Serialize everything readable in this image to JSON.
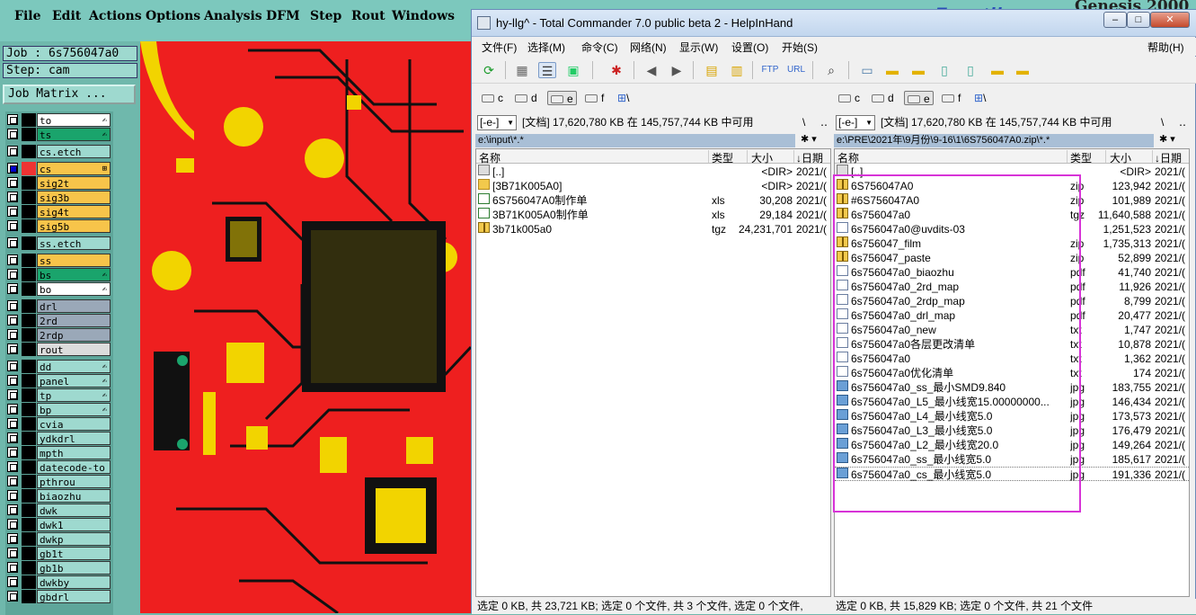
{
  "genesis": {
    "menu": [
      "File",
      "Edit",
      "Actions",
      "Options",
      "Analysis",
      "DFM",
      "Step",
      "Rout",
      "Windows"
    ],
    "brand": "Genesis 2000",
    "logo_text": "Frontline",
    "job": "Job : 6s756047a0",
    "step": "Step: cam",
    "job_matrix_button": "Job Matrix ...",
    "layers": [
      {
        "name": "to",
        "color": "#ffffff",
        "mark": "✍"
      },
      {
        "name": "ts",
        "color": "#1aa46c",
        "mark": "✍"
      },
      {
        "name": "cs.etch",
        "color": "#9ed9cf",
        "mark": ""
      },
      {
        "name": "cs",
        "color": "#f7c44a",
        "mark": "⊞",
        "selected": true,
        "swatch": "#e33"
      },
      {
        "name": "sig2t",
        "color": "#f7c44a",
        "mark": ""
      },
      {
        "name": "sig3b",
        "color": "#f7c44a",
        "mark": ""
      },
      {
        "name": "sig4t",
        "color": "#f7c44a",
        "mark": ""
      },
      {
        "name": "sig5b",
        "color": "#f7c44a",
        "mark": ""
      },
      {
        "name": "ss.etch",
        "color": "#9ed9cf",
        "mark": ""
      },
      {
        "name": "ss",
        "color": "#f7c44a",
        "mark": ""
      },
      {
        "name": "bs",
        "color": "#1aa46c",
        "mark": "✍"
      },
      {
        "name": "bo",
        "color": "#ffffff",
        "mark": "✍"
      },
      {
        "name": "drl",
        "color": "#9aa8b8",
        "mark": ""
      },
      {
        "name": "2rd",
        "color": "#9aa8b8",
        "mark": ""
      },
      {
        "name": "2rdp",
        "color": "#9aa8b8",
        "mark": ""
      },
      {
        "name": "rout",
        "color": "#dcdcdc",
        "mark": ""
      },
      {
        "name": "dd",
        "color": "#9ed9cf",
        "mark": "✍"
      },
      {
        "name": "panel",
        "color": "#9ed9cf",
        "mark": "✍"
      },
      {
        "name": "tp",
        "color": "#9ed9cf",
        "mark": "✍"
      },
      {
        "name": "bp",
        "color": "#9ed9cf",
        "mark": "✍"
      },
      {
        "name": "cvia",
        "color": "#9ed9cf",
        "mark": ""
      },
      {
        "name": "ydkdrl",
        "color": "#9ed9cf",
        "mark": ""
      },
      {
        "name": "mpth",
        "color": "#9ed9cf",
        "mark": ""
      },
      {
        "name": "datecode-to",
        "color": "#9ed9cf",
        "mark": ""
      },
      {
        "name": "pthrou",
        "color": "#9ed9cf",
        "mark": ""
      },
      {
        "name": "biaozhu",
        "color": "#9ed9cf",
        "mark": ""
      },
      {
        "name": "dwk",
        "color": "#9ed9cf",
        "mark": ""
      },
      {
        "name": "dwk1",
        "color": "#9ed9cf",
        "mark": ""
      },
      {
        "name": "dwkp",
        "color": "#9ed9cf",
        "mark": ""
      },
      {
        "name": "gb1t",
        "color": "#9ed9cf",
        "mark": ""
      },
      {
        "name": "gb1b",
        "color": "#9ed9cf",
        "mark": ""
      },
      {
        "name": "dwkby",
        "color": "#9ed9cf",
        "mark": ""
      },
      {
        "name": "gbdrl",
        "color": "#9ed9cf",
        "mark": ""
      }
    ]
  },
  "tc": {
    "title": "hy-llg^ - Total Commander 7.0 public beta 2 - HelpInHand",
    "menu": [
      "文件(F)",
      "选择(M)",
      "命令(C)",
      "网络(N)",
      "显示(W)",
      "设置(O)",
      "开始(S)"
    ],
    "help": "帮助(H)",
    "drives": [
      "c",
      "d",
      "e",
      "f"
    ],
    "net_drive": "\\",
    "left": {
      "drive_select": "[-e-]",
      "free_info": "[文档]  17,620,780 KB 在 145,757,744 KB 中可用",
      "path": "e:\\input\\*.*",
      "headers": {
        "name": "名称",
        "type": "类型",
        "size": "大小",
        "date": "↓日期"
      },
      "files": [
        {
          "name": "[..]",
          "type": "",
          "size": "<DIR>",
          "date": "2021/(",
          "icon": "up"
        },
        {
          "name": "[3B71K005A0]",
          "type": "",
          "size": "<DIR>",
          "date": "2021/(",
          "icon": "folder"
        },
        {
          "name": "6S756047A0制作单",
          "type": "xls",
          "size": "30,208",
          "date": "2021/(",
          "icon": "xls"
        },
        {
          "name": "3B71K005A0制作单",
          "type": "xls",
          "size": "29,184",
          "date": "2021/(",
          "icon": "xls"
        },
        {
          "name": "3b71k005a0",
          "type": "tgz",
          "size": "24,231,701",
          "date": "2021/(",
          "icon": "zip"
        }
      ]
    },
    "right": {
      "drive_select": "[-e-]",
      "free_info": "[文档]  17,620,780 KB 在 145,757,744 KB 中可用",
      "path": "e:\\PRE\\2021年\\9月份\\9-16\\1\\6S756047A0.zip\\*.*",
      "headers": {
        "name": "名称",
        "type": "类型",
        "size": "大小",
        "date": "↓日期"
      },
      "files": [
        {
          "name": "[..]",
          "type": "",
          "size": "<DIR>",
          "date": "2021/(",
          "icon": "up"
        },
        {
          "name": "6S756047A0",
          "type": "zip",
          "size": "123,942",
          "date": "2021/(",
          "icon": "zip"
        },
        {
          "name": "#6S756047A0",
          "type": "zip",
          "size": "101,989",
          "date": "2021/(",
          "icon": "zip"
        },
        {
          "name": "6s756047a0",
          "type": "tgz",
          "size": "11,640,588",
          "date": "2021/(",
          "icon": "zip"
        },
        {
          "name": "6s756047a0@uvdits-03",
          "type": "",
          "size": "1,251,523",
          "date": "2021/(",
          "icon": "doc"
        },
        {
          "name": "6s756047_film",
          "type": "zip",
          "size": "1,735,313",
          "date": "2021/(",
          "icon": "zip"
        },
        {
          "name": "6s756047_paste",
          "type": "zip",
          "size": "52,899",
          "date": "2021/(",
          "icon": "zip"
        },
        {
          "name": "6s756047a0_biaozhu",
          "type": "pdf",
          "size": "41,740",
          "date": "2021/(",
          "icon": "doc"
        },
        {
          "name": "6s756047a0_2rd_map",
          "type": "pdf",
          "size": "11,926",
          "date": "2021/(",
          "icon": "doc"
        },
        {
          "name": "6s756047a0_2rdp_map",
          "type": "pdf",
          "size": "8,799",
          "date": "2021/(",
          "icon": "doc"
        },
        {
          "name": "6s756047a0_drl_map",
          "type": "pdf",
          "size": "20,477",
          "date": "2021/(",
          "icon": "doc"
        },
        {
          "name": "6s756047a0_new",
          "type": "txt",
          "size": "1,747",
          "date": "2021/(",
          "icon": "doc"
        },
        {
          "name": "6s756047a0各层更改清单",
          "type": "txt",
          "size": "10,878",
          "date": "2021/(",
          "icon": "doc"
        },
        {
          "name": "6s756047a0",
          "type": "txt",
          "size": "1,362",
          "date": "2021/(",
          "icon": "doc"
        },
        {
          "name": "6s756047a0优化清单",
          "type": "txt",
          "size": "174",
          "date": "2021/(",
          "icon": "doc"
        },
        {
          "name": "6s756047a0_ss_最小SMD9.840",
          "type": "jpg",
          "size": "183,755",
          "date": "2021/(",
          "icon": "img"
        },
        {
          "name": "6s756047a0_L5_最小线宽15.00000000...",
          "type": "jpg",
          "size": "146,434",
          "date": "2021/(",
          "icon": "img"
        },
        {
          "name": "6s756047a0_L4_最小线宽5.0",
          "type": "jpg",
          "size": "173,573",
          "date": "2021/(",
          "icon": "img"
        },
        {
          "name": "6s756047a0_L3_最小线宽5.0",
          "type": "jpg",
          "size": "176,479",
          "date": "2021/(",
          "icon": "img"
        },
        {
          "name": "6s756047a0_L2_最小线宽20.0",
          "type": "jpg",
          "size": "149,264",
          "date": "2021/(",
          "icon": "img"
        },
        {
          "name": "6s756047a0_ss_最小线宽5.0",
          "type": "jpg",
          "size": "185,617",
          "date": "2021/(",
          "icon": "img"
        },
        {
          "name": "6s756047a0_cs_最小线宽5.0",
          "type": "jpg",
          "size": "191,336",
          "date": "2021/(",
          "icon": "img"
        }
      ]
    },
    "status_left": "选定 0 KB, 共 23,721 KB; 选定 0 个文件, 共 3 个文件, 选定 0 个文件,",
    "status_right": "选定 0 KB, 共 15,829 KB; 选定 0 个文件, 共 21 个文件"
  },
  "colors": {
    "pcb_red": "#ee1f1f",
    "pcb_copper": "#f2d400",
    "pcb_dark": "#111111",
    "highlight": "#d733d7"
  }
}
